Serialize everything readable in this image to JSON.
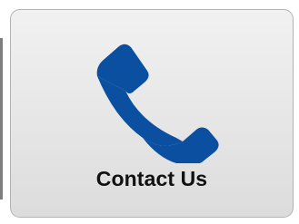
{
  "tile": {
    "label": "Contact Us",
    "icon": "phone-icon",
    "icon_color": "#0a4fa0"
  }
}
